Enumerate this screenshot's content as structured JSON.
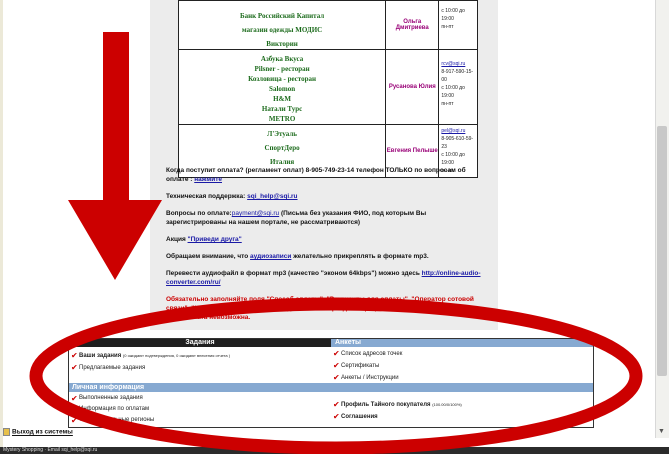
{
  "partners_table": {
    "rows": [
      {
        "names": [
          "Банк Российский Капитал",
          "магазин одежды МОДИС",
          "Викторин"
        ],
        "manager": "Ольга Дмитриева",
        "contact": [
          "с 10:00 до 19:00",
          "пн-пт"
        ]
      },
      {
        "names": [
          "Азбука Вкуса",
          "Pilsner - ресторан",
          "Козловица - ресторан",
          "Salomon",
          "H&M",
          "Натали Турс",
          "METRO"
        ],
        "manager": "Русанова Юлия",
        "contact": [
          "rcv@sqi.ru",
          "8-917-590-15-00",
          "с 10:00 до 19:00",
          "пн-пт"
        ]
      },
      {
        "names": [
          "Л'Этуаль",
          "СпортДеро",
          "Италия"
        ],
        "manager": "Евгения Пелыше",
        "contact": [
          "pel@sqi.ru",
          "8-905-610-59-23",
          "с 10:00 до 19:00",
          "пн-пт"
        ]
      }
    ]
  },
  "info": {
    "payment_q": "Когда поступит оплата? (регламент оплат) 8-905-749-23-14 телефон ТОЛЬКО по вопросам об оплате :",
    "payment_link": "нажмите",
    "support_label": "Техническая поддержка:",
    "support_email": "sqi_help@sqi.ru",
    "payment_questions_label": "Вопросы по оплате:",
    "payment_email": "payment@sqi.ru",
    "payment_note": "(Письма без указания ФИО, под которым Вы зарегистрированы на нашем портале, не рассматриваются)",
    "promo_label": "Акция",
    "promo_link": "\"Приведи друга\"",
    "audio_pre": "Обращаем внимание, что",
    "audio_link": "аудиозаписи",
    "audio_post": "желательно прикреплять в формате mp3.",
    "convert_text": "Перевести аудиофайл в формат mp3 (качество \"эконом 64kbps\") можно здесь",
    "convert_link": "http://online-audio-converter.com/ru/",
    "warning": "Обязательно заполняйте поля \"Способ оплаты\", \"Реквизиты для оплаты\", \"Оператор сотовой связи\", \"Номер телефона для перевода оплаты\" в разделе Профиль Тайного покупателя. Без этого оплата невозможна."
  },
  "menu": {
    "tasks_header": "Задания",
    "forms_header": "Анкеты",
    "my_tasks": "Ваши задания",
    "my_tasks_note": "(0 ожидают подтверждения, 0 ожидают внесения отчета )",
    "offered_tasks": "Предлагаемые задания",
    "store_list": "Список адресов точек",
    "certificates": "Сертификаты",
    "forms_instructions": "Анкеты / Инструкции",
    "personal_header": "Личная информация",
    "completed_tasks": "Выполненные задания",
    "payment_info": "Информация по оплатам",
    "regions": "Территориальные регионы",
    "profile": "Профиль Тайного покупателя",
    "profile_note": "(100.00/0/100%)",
    "agreements": "Соглашения"
  },
  "footer": {
    "logout": "Выход из системы",
    "status": "Mystery Shopping · Email sqi_help@sqi.ru"
  },
  "colors": {
    "annotation_red": "#cc0000",
    "names_green": "#1c6b1c",
    "manager_purple": "#990077",
    "menu_blue": "#86a9d1"
  }
}
